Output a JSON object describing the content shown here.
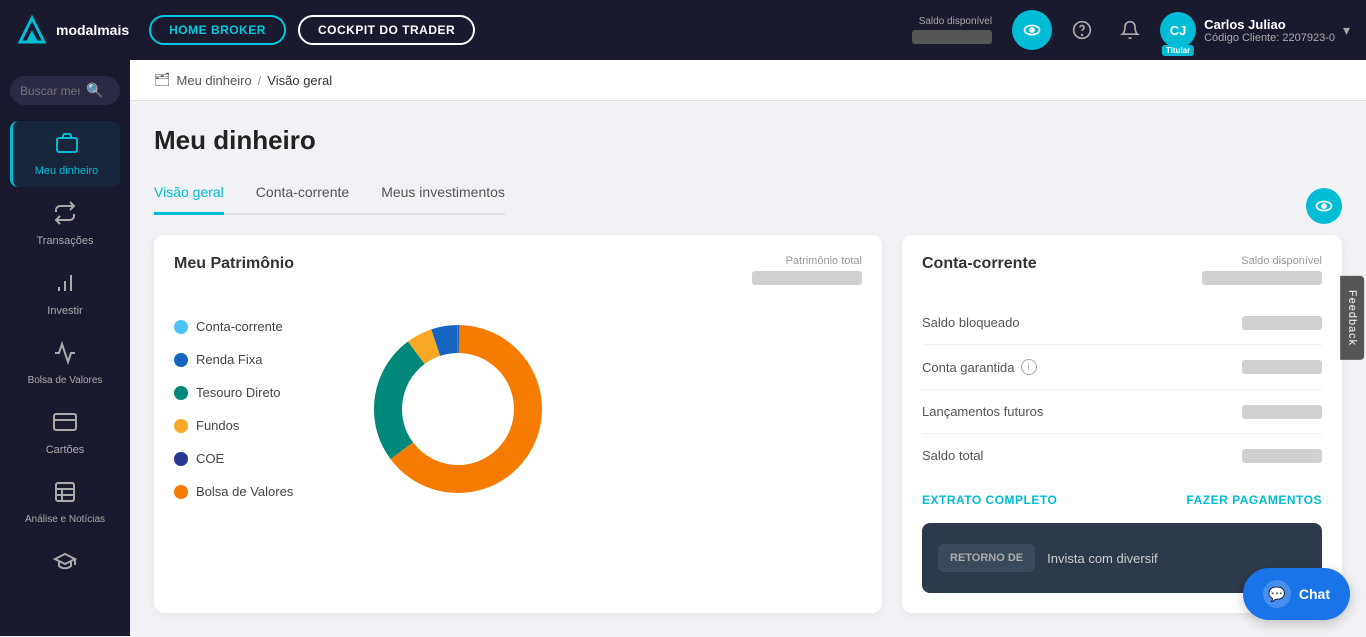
{
  "topnav": {
    "logo_text": "modalmais",
    "btn_home_broker": "HOME BROKER",
    "btn_cockpit": "COCKPIT DO TRADER",
    "saldo_label": "Saldo disponível",
    "eye_label": "toggle-visibility",
    "user": {
      "initials": "CJ",
      "name": "Carlos Juliao",
      "code_label": "Código Cliente:",
      "code": "2207923-0",
      "badge": "Titular"
    }
  },
  "sidebar": {
    "search_placeholder": "Buscar menu",
    "items": [
      {
        "id": "meu-dinheiro",
        "label": "Meu dinheiro",
        "icon": "🏦",
        "active": true
      },
      {
        "id": "transacoes",
        "label": "Transações",
        "icon": "🔄",
        "active": false
      },
      {
        "id": "investir",
        "label": "Investir",
        "icon": "📊",
        "active": false
      },
      {
        "id": "bolsa-valores",
        "label": "Bolsa de Valores",
        "icon": "📈",
        "active": false
      },
      {
        "id": "cartoes",
        "label": "Cartões",
        "icon": "💳",
        "active": false
      },
      {
        "id": "analise-noticias",
        "label": "Análise e Notícias",
        "icon": "📰",
        "active": false
      },
      {
        "id": "educacao",
        "label": "Educação",
        "icon": "🎓",
        "active": false
      }
    ]
  },
  "breadcrumb": {
    "home": "Meu dinheiro",
    "sep": "/",
    "current": "Visão geral"
  },
  "page": {
    "title": "Meu dinheiro"
  },
  "tabs": [
    {
      "id": "visao-geral",
      "label": "Visão geral",
      "active": true
    },
    {
      "id": "conta-corrente",
      "label": "Conta-corrente",
      "active": false
    },
    {
      "id": "meus-investimentos",
      "label": "Meus investimentos",
      "active": false
    }
  ],
  "patrimonio_card": {
    "title": "Meu Patrimônio",
    "total_label": "Patrimônio total",
    "legend": [
      {
        "id": "conta-corrente",
        "label": "Conta-corrente",
        "color": "#4fc3f7"
      },
      {
        "id": "renda-fixa",
        "label": "Renda Fixa",
        "color": "#1565c0"
      },
      {
        "id": "tesouro-direto",
        "label": "Tesouro Direto",
        "color": "#00897b"
      },
      {
        "id": "fundos",
        "label": "Fundos",
        "color": "#f9a825"
      },
      {
        "id": "coe",
        "label": "COE",
        "color": "#283593"
      },
      {
        "id": "bolsa-valores",
        "label": "Bolsa de Valores",
        "color": "#f57c00"
      }
    ],
    "donut": {
      "segments": [
        {
          "label": "Bolsa de Valores",
          "color": "#f57c00",
          "percent": 65
        },
        {
          "label": "Tesouro Direto",
          "color": "#00897b",
          "percent": 25
        },
        {
          "label": "Fundos",
          "color": "#f9a825",
          "percent": 5
        },
        {
          "label": "Renda Fixa",
          "color": "#1565c0",
          "percent": 5
        }
      ]
    }
  },
  "conta_card": {
    "title": "Conta-corrente",
    "saldo_label": "Saldo disponível",
    "rows": [
      {
        "id": "saldo-bloqueado",
        "label": "Saldo bloqueado",
        "has_info": false
      },
      {
        "id": "conta-garantida",
        "label": "Conta garantida",
        "has_info": true
      },
      {
        "id": "lancamentos-futuros",
        "label": "Lançamentos futuros",
        "has_info": false
      },
      {
        "id": "saldo-total",
        "label": "Saldo total",
        "has_info": false
      }
    ],
    "btn_extrato": "EXTRATO COMPLETO",
    "btn_pagamento": "FAZER PAGAMENTOS"
  },
  "bottom_banner": {
    "text": "Invista com diversif",
    "subtitle": "RETORNO DE"
  },
  "feedback": {
    "label": "Feedback"
  },
  "chat": {
    "label": "Chat"
  }
}
